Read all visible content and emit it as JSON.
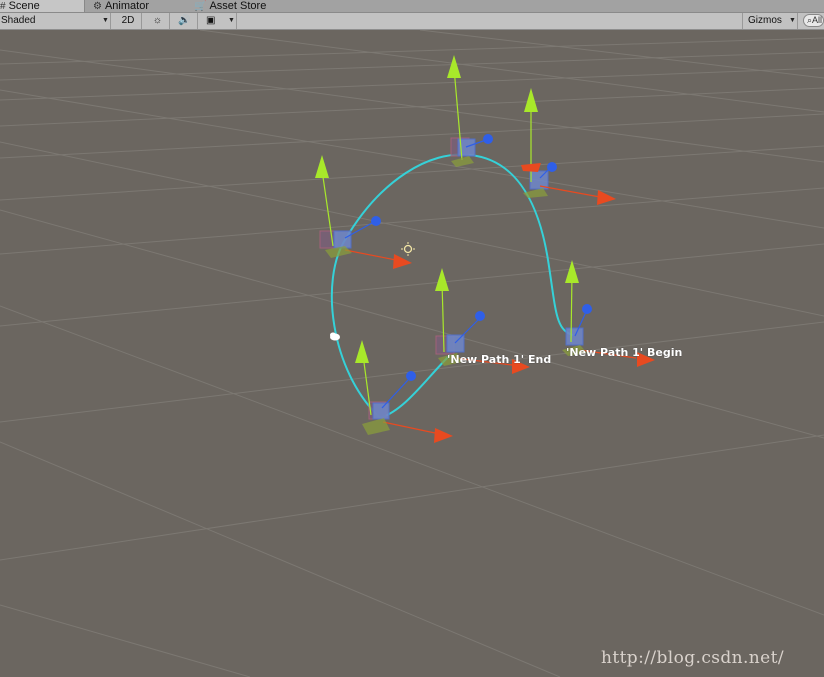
{
  "tabs": [
    {
      "icon": "scene-icon",
      "label": "Scene",
      "active": true
    },
    {
      "icon": "animator-icon",
      "label": "Animator",
      "active": false
    },
    {
      "icon": "asset-store-icon",
      "label": "Asset Store",
      "active": false
    }
  ],
  "toolbar": {
    "shading_mode": "Shaded",
    "mode_2d": "2D",
    "lighting_icon": "sun-icon",
    "audio_icon": "speaker-icon",
    "effects_icon": "image-icon",
    "gizmos_label": "Gizmos",
    "search_placeholder": "All"
  },
  "scene": {
    "path_color": "#35d1d8",
    "path_begin_label": "'New Path 1' Begin",
    "path_end_label": "'New Path 1' End",
    "axis_colors": {
      "x": "#e84a20",
      "y": "#a8e82a",
      "z": "#2f5fe8"
    },
    "watermark": "http://blog.csdn.net/"
  }
}
